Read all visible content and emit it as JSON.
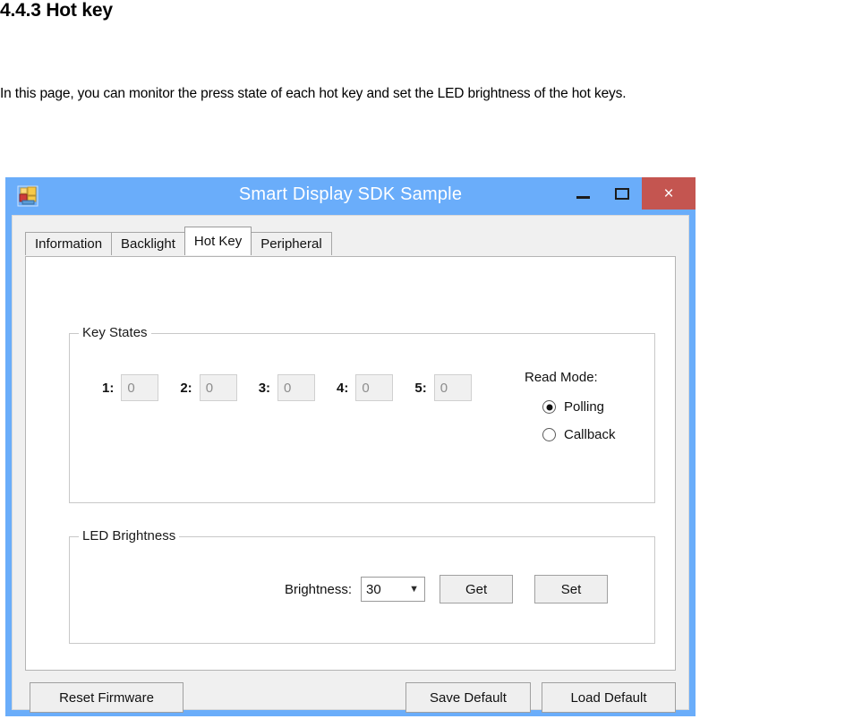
{
  "document": {
    "heading": "4.4.3 Hot key",
    "paragraph": "In this page, you can monitor the press state of each hot key and set the LED brightness of the hot keys."
  },
  "window": {
    "title": "Smart Display SDK Sample",
    "app_icon": "application-icon",
    "titlebar_color": "#6aadfa",
    "close_button_color": "#c45550",
    "controls": {
      "minimize": "minimize-icon",
      "maximize": "maximize-icon",
      "close": "×"
    }
  },
  "tabs": [
    {
      "label": "Information",
      "active": false
    },
    {
      "label": "Backlight",
      "active": false
    },
    {
      "label": "Hot Key",
      "active": true
    },
    {
      "label": "Peripheral",
      "active": false
    }
  ],
  "key_states": {
    "group_title": "Key States",
    "keys": [
      {
        "label": "1:",
        "value": "0"
      },
      {
        "label": "2:",
        "value": "0"
      },
      {
        "label": "3:",
        "value": "0"
      },
      {
        "label": "4:",
        "value": "0"
      },
      {
        "label": "5:",
        "value": "0"
      }
    ],
    "read_mode": {
      "label": "Read Mode:",
      "options": [
        {
          "label": "Polling",
          "selected": true
        },
        {
          "label": "Callback",
          "selected": false
        }
      ]
    }
  },
  "led_brightness": {
    "group_title": "LED Brightness",
    "field_label": "Brightness:",
    "value": "30",
    "chevron": "chevron-down-icon",
    "get_label": "Get",
    "set_label": "Set"
  },
  "bottom_buttons": {
    "reset_firmware": "Reset Firmware",
    "save_default": "Save Default",
    "load_default": "Load Default"
  }
}
